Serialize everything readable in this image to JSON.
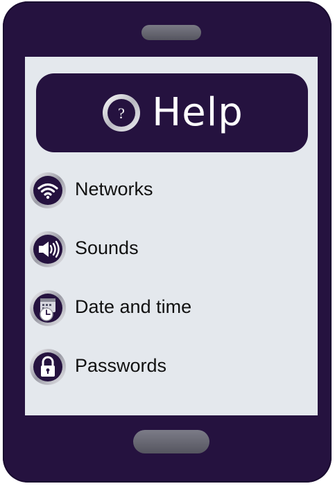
{
  "header": {
    "title": "Help",
    "icon": "question-mark-icon",
    "icon_glyph": "?"
  },
  "menu": {
    "items": [
      {
        "label": "Networks",
        "icon": "wifi-icon"
      },
      {
        "label": "Sounds",
        "icon": "speaker-icon"
      },
      {
        "label": "Date and time",
        "icon": "calendar-clock-icon"
      },
      {
        "label": "Passwords",
        "icon": "lock-icon"
      }
    ]
  },
  "colors": {
    "device": "#25123f",
    "screen": "#e4e8ed",
    "button": "#6b6b76",
    "text": "#111111"
  }
}
